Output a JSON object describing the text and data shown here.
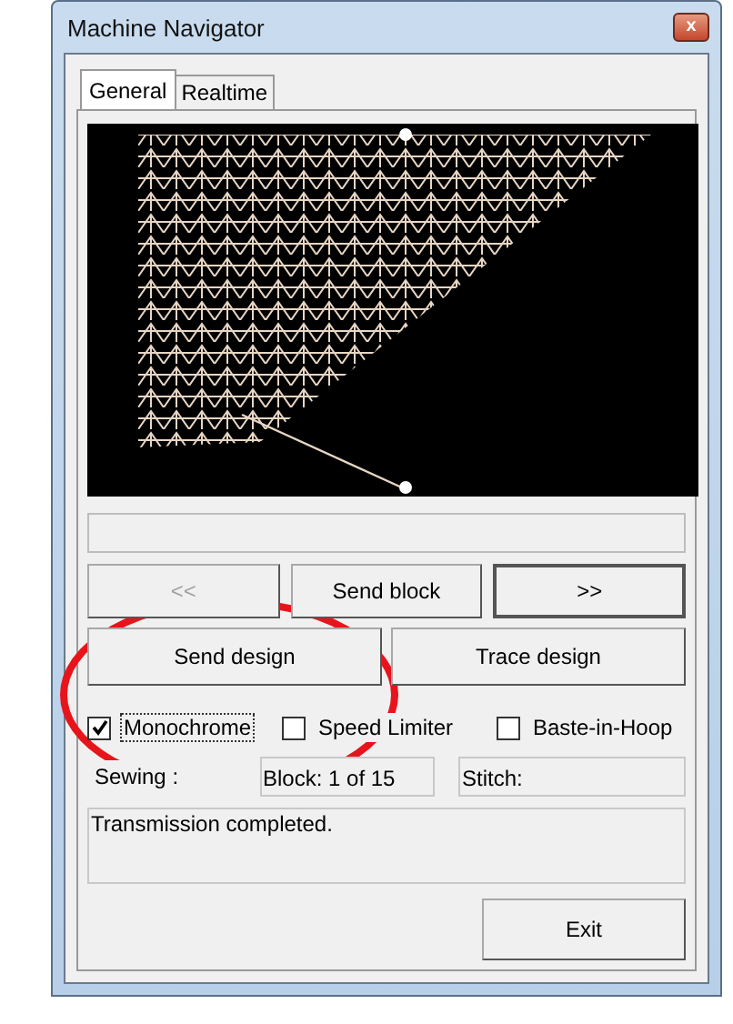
{
  "window": {
    "title": "Machine Navigator",
    "close": "x"
  },
  "tabs": [
    {
      "label": "General",
      "selected": true
    },
    {
      "label": "Realtime",
      "selected": false
    }
  ],
  "nav_buttons": [
    {
      "label": "<<",
      "disabled": true,
      "default": false
    },
    {
      "label": "Send block",
      "disabled": false,
      "default": false
    },
    {
      "label": ">>",
      "disabled": false,
      "default": true
    }
  ],
  "action_buttons": [
    {
      "label": "Send design"
    },
    {
      "label": "Trace design"
    }
  ],
  "options": [
    {
      "label": "Monochrome",
      "checked": true,
      "focused": true
    },
    {
      "label": "Speed Limiter",
      "checked": false,
      "focused": false
    },
    {
      "label": "Baste-in-Hoop",
      "checked": false,
      "focused": false
    }
  ],
  "status": {
    "label": "Sewing :",
    "block": "Block: 1 of 15",
    "stitch": "Stitch:"
  },
  "message": "Transmission completed.",
  "exit_button": "Exit"
}
